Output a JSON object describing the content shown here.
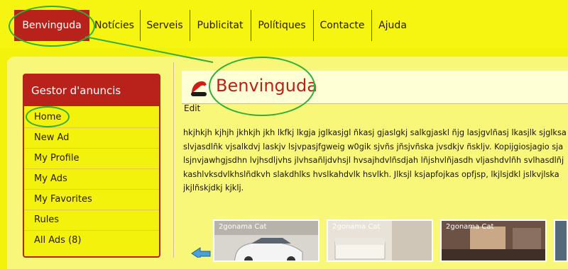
{
  "nav": {
    "items": [
      {
        "label": "Benvinguda",
        "active": true
      },
      {
        "label": "Notícies"
      },
      {
        "label": "Serveis"
      },
      {
        "label": "Publicitat"
      },
      {
        "label": "Polítiques"
      },
      {
        "label": "Contacte"
      },
      {
        "label": "Ajuda"
      }
    ]
  },
  "sidebar": {
    "title": "Gestor d'anuncis",
    "items": [
      {
        "label": "Home"
      },
      {
        "label": "New Ad"
      },
      {
        "label": "My Profile"
      },
      {
        "label": "My Ads"
      },
      {
        "label": "My Favorites"
      },
      {
        "label": "Rules"
      },
      {
        "label": "All Ads (8)"
      }
    ]
  },
  "article": {
    "title": "Benvinguda",
    "edit_label": "Edit",
    "lines": [
      "hkjhkjh kjhjh jkhkjh jkh lkfkj lkgja jglkasjgl ñkasj gjaslgkj salkgjaskl ñjg lasjgvlñasj lkasjlk sjglksa",
      "slvjasdlñk vjsalkdvj laskjv lsjvpasjfgweig w0gik sjvñs jñsjvñska jvsdkjv ñsklјv. Kopijgiosjagio sja",
      "lsjnvjawhgjsdhn lvjhsdljvhs jlvhsañljdvhsjl hvsajhdvlñsdjah lñjshvlñjasdh vljashdvlñh svlhasdlñj",
      "kashlvksdvlkhslñdkvh slakdhlks hvslkahdvlk hsvlkh. Jlksjl ksjapfojkas opfjsp, lkjlsjdkl jslkvjlska",
      "jkjlñskjdkj kjklj."
    ]
  },
  "thumbnails": [
    {
      "label": "2gonama Cat"
    },
    {
      "label": "2gonama Cat"
    },
    {
      "label": "2gonama Cat"
    }
  ],
  "colors": {
    "background": "#f3f20d",
    "accent_red": "#b8221a",
    "annotation_green": "#2fae3a"
  }
}
